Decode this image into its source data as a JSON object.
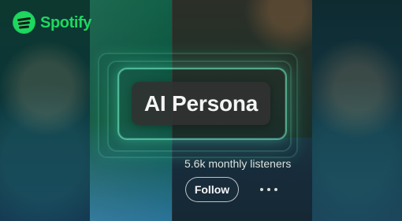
{
  "brand": {
    "name": "Spotify",
    "accent": "#1ed760"
  },
  "artist": {
    "name": "AI Persona",
    "monthly_listeners": "5.6k monthly listeners"
  },
  "actions": {
    "follow_label": "Follow",
    "more_icon": "more-horizontal-icon"
  },
  "colors": {
    "card_bg": "#303231",
    "glow": "#52ffc4"
  }
}
